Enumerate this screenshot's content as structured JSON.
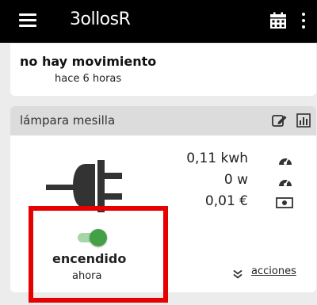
{
  "app": {
    "title": "3ollosR"
  },
  "toolbar": {
    "icons": [
      "menu-icon",
      "calendar-icon",
      "more-vert-icon"
    ]
  },
  "status_card": {
    "title": "no hay movimiento",
    "subtitle": "hace 6 horas"
  },
  "device_card": {
    "name": "lámpara mesilla",
    "header_icons": [
      "edit-icon",
      "chart-icon"
    ],
    "image_icon": "plug-icon",
    "metrics": [
      {
        "value": "0,11 kwh",
        "icon": "gauge-icon"
      },
      {
        "value": "0 w",
        "icon": "gauge-icon"
      },
      {
        "value": "0,01 €",
        "icon": "banknote-icon"
      }
    ],
    "toggle": {
      "on": true
    },
    "state_label": "encendido",
    "state_time": "ahora",
    "actions_label": "acciones"
  },
  "colors": {
    "toolbar_bg": "#000000",
    "toggle_on": "#43a047",
    "highlight": "#e60000",
    "page_bg": "#ececec"
  }
}
